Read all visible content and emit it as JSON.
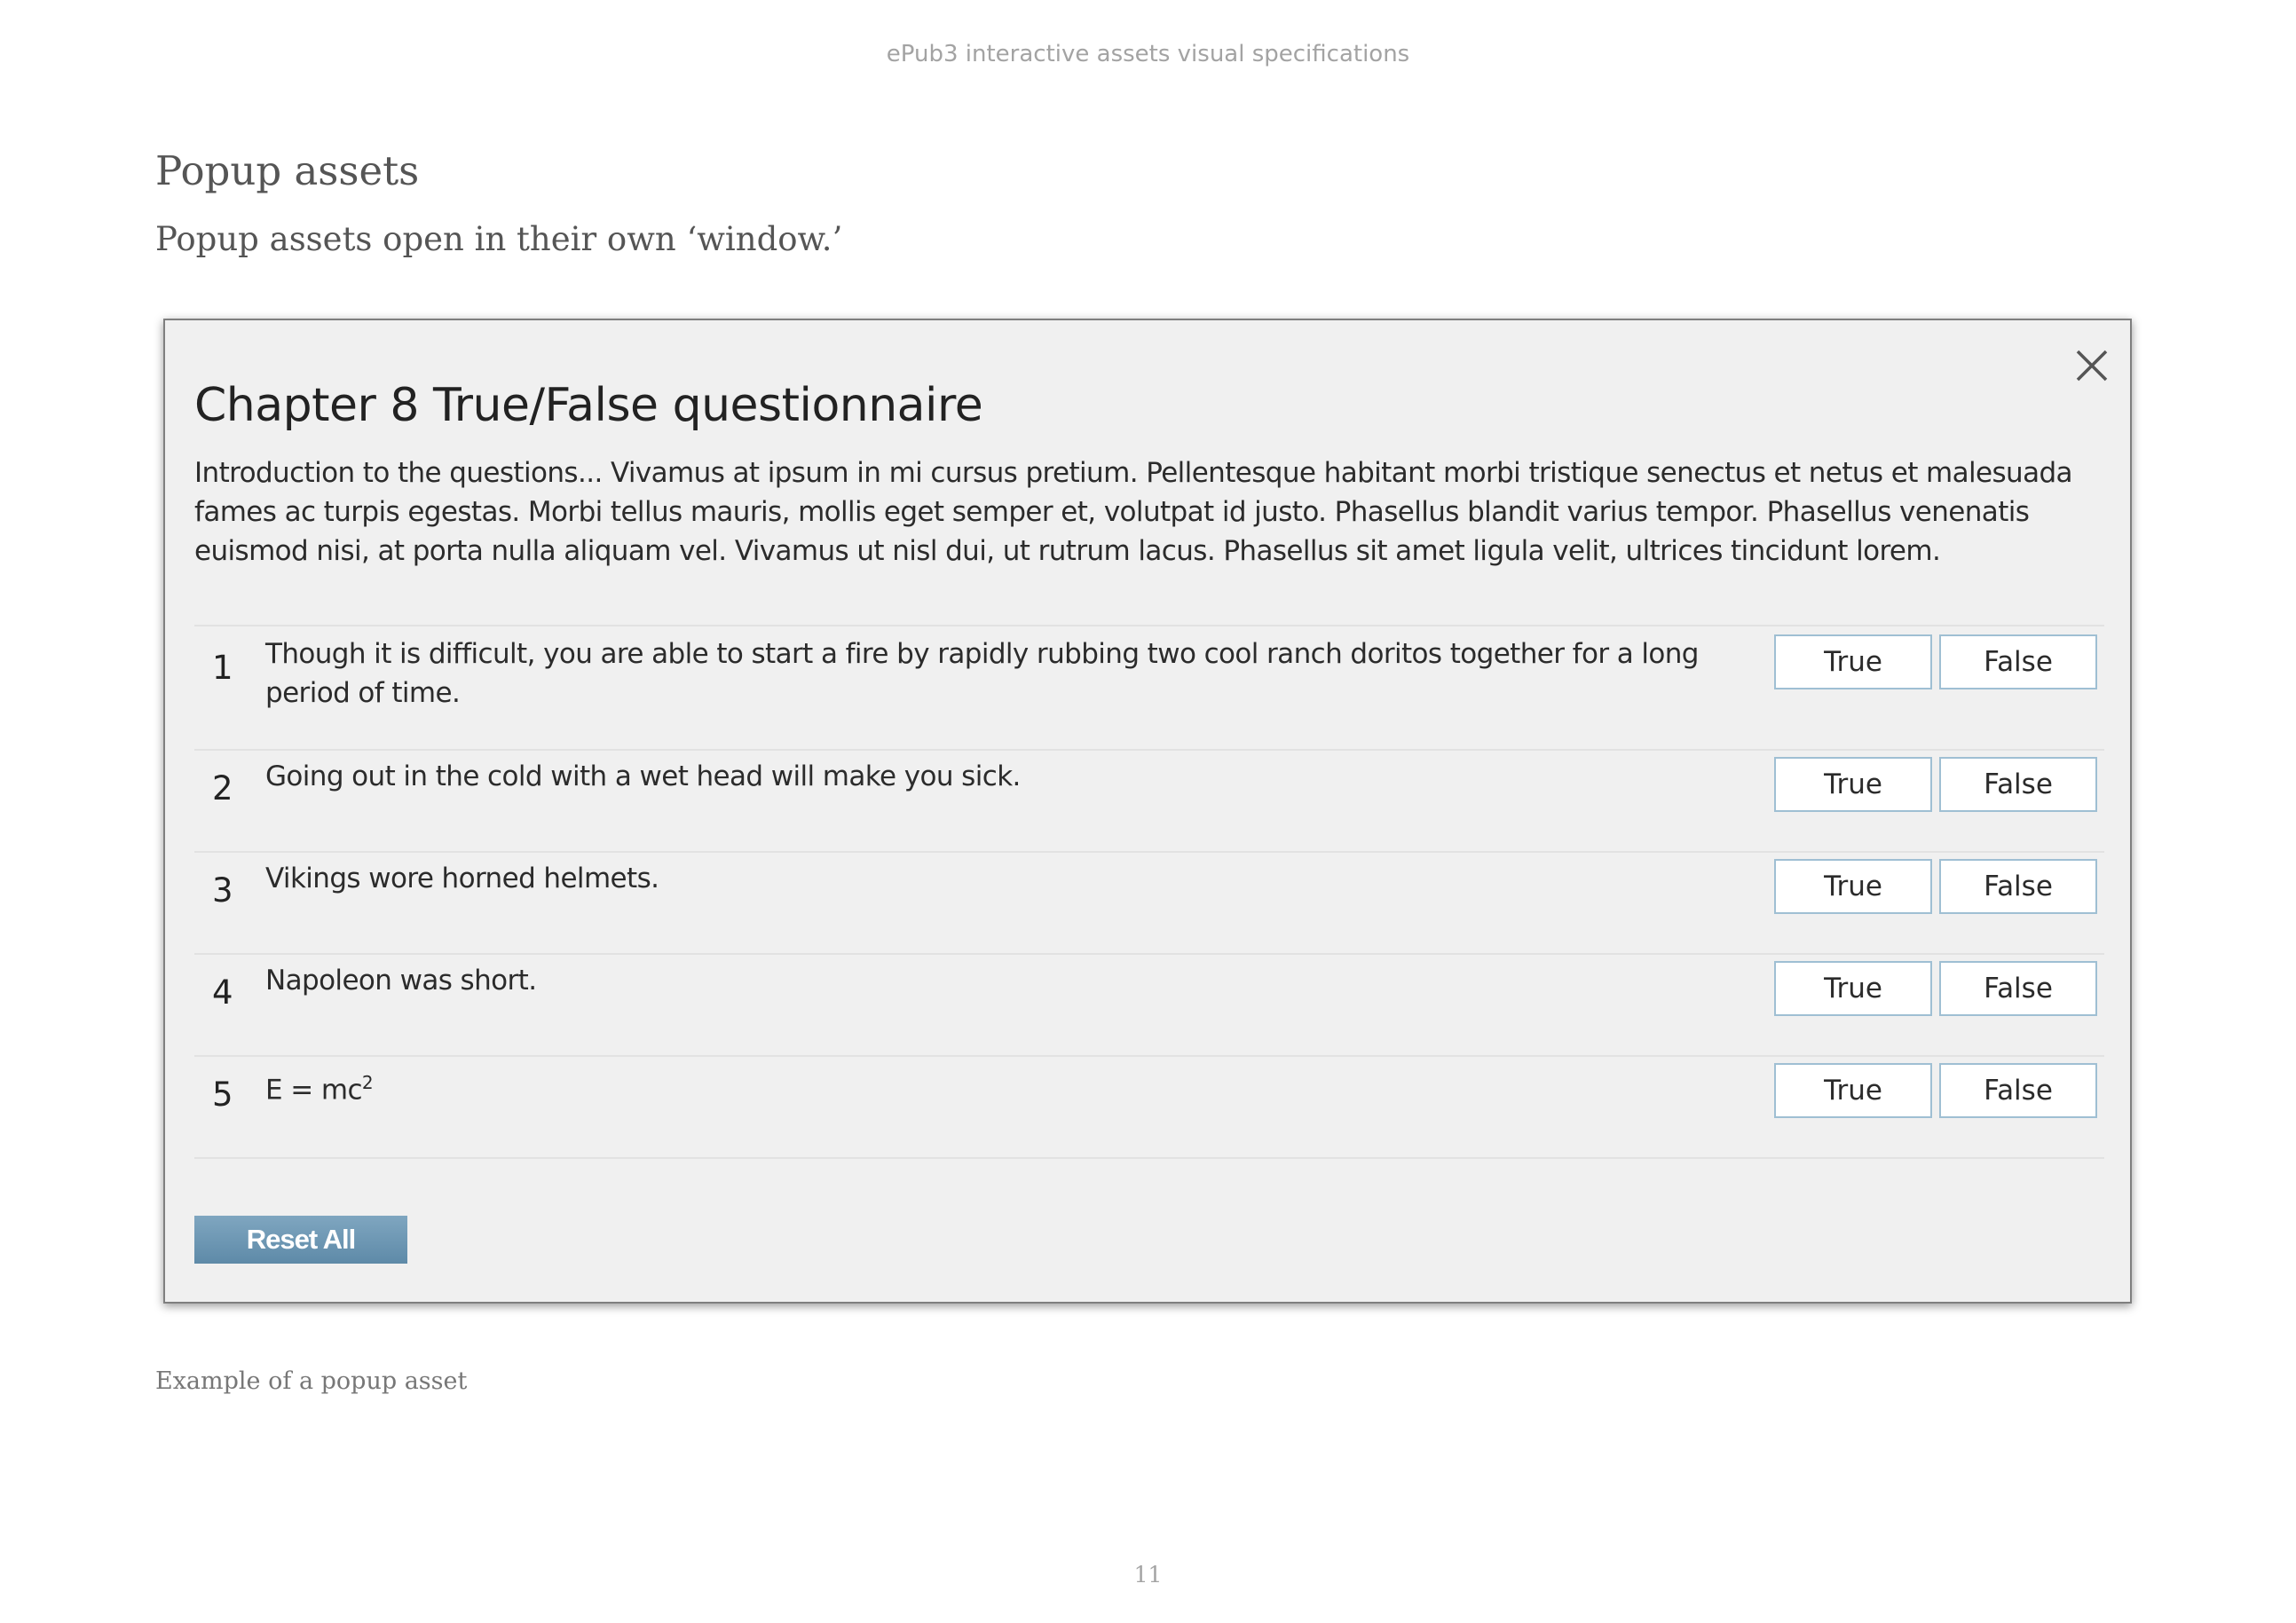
{
  "page": {
    "header": "ePub3 interactive assets visual specifications",
    "page_number": "11"
  },
  "section": {
    "title": "Popup assets",
    "description": "Popup assets open in their own ‘window.’",
    "caption": "Example of a popup asset"
  },
  "popup": {
    "close_icon": "close-icon",
    "title": "Chapter 8 True/False questionnaire",
    "intro": "Introduction to the questions... Vivamus at ipsum in mi cursus pretium. Pellentesque habitant morbi tristique senectus et netus et malesuada fames ac turpis egestas. Morbi tellus mauris, mollis eget semper et, volutpat id justo. Phasellus blandit varius tempor. Phasellus venenatis euismod nisi, at porta nulla aliquam vel. Vivamus ut nisl dui, ut rutrum lacus. Phasellus sit amet ligula velit, ultrices tincidunt lorem.",
    "questions": [
      {
        "number": "1",
        "text": "Though it is difficult, you are able to start a fire by rapidly rubbing two cool ranch doritos together for a long period of time.",
        "true_label": "True",
        "false_label": "False"
      },
      {
        "number": "2",
        "text": "Going out in the cold with a wet head will make you sick.",
        "true_label": "True",
        "false_label": "False"
      },
      {
        "number": "3",
        "text": "Vikings wore horned helmets.",
        "true_label": "True",
        "false_label": "False"
      },
      {
        "number": "4",
        "text": "Napoleon was short.",
        "true_label": "True",
        "false_label": "False"
      },
      {
        "number": "5",
        "text": "E = mc",
        "text_superscript": "2",
        "true_label": "True",
        "false_label": "False"
      }
    ],
    "reset_label": "Reset All"
  },
  "colors": {
    "popup_background": "#f0f0f0",
    "button_border": "#9fbfd3",
    "reset_button": "#6f99b5",
    "muted_text": "#a3a3a3"
  }
}
